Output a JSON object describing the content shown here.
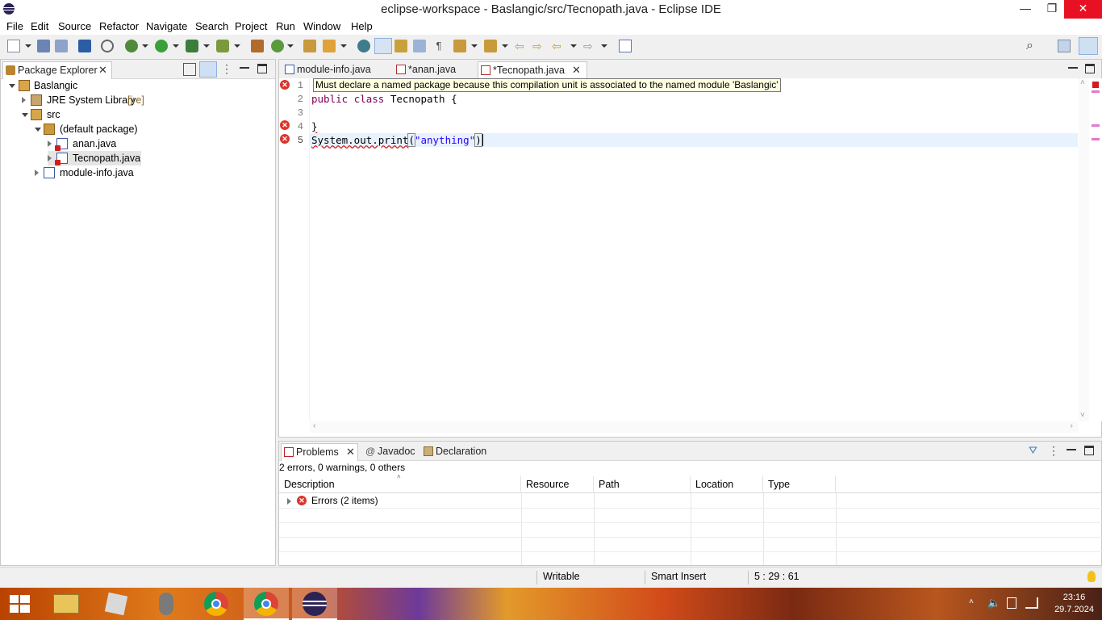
{
  "window": {
    "title": "eclipse-workspace - Baslangic/src/Tecnopath.java - Eclipse IDE",
    "controls": {
      "minimize": "—",
      "maximize": "❐",
      "close": "✕"
    }
  },
  "menu": {
    "items": [
      "File",
      "Edit",
      "Source",
      "Refactor",
      "Navigate",
      "Search",
      "Project",
      "Run",
      "Window",
      "Help"
    ]
  },
  "package_explorer": {
    "tab_label": "Package Explorer",
    "tree": {
      "project": "Baslangic",
      "jre_label": "JRE System Library",
      "jre_suffix": "[jre]",
      "src": "src",
      "default_package": "(default package)",
      "file_anan": "anan.java",
      "file_tecnopath": "Tecnopath.java",
      "file_module_info": "module-info.java"
    }
  },
  "editor": {
    "tabs": [
      "module-info.java",
      "*anan.java",
      "*Tecnopath.java"
    ],
    "active_tab": 2,
    "line_numbers": [
      "1",
      "2",
      "3",
      "4",
      "5"
    ],
    "tooltip": "Must declare a named package because this compilation unit is associated to the named module 'Baslangic'",
    "code": {
      "line2_kw1": "public",
      "line2_kw2": "class",
      "line2_rest": " Tecnopath {",
      "line4": "}",
      "line5_pre": "System.out.print",
      "line5_paren": "(",
      "line5_str": "\"anything\"",
      "line5_close": ")"
    }
  },
  "problems_view": {
    "tabs": [
      "Problems",
      "Javadoc",
      "Declaration"
    ],
    "summary": "2 errors, 0 warnings, 0 others",
    "columns": [
      "Description",
      "Resource",
      "Path",
      "Location",
      "Type"
    ],
    "rows": [
      {
        "label": "Errors (2 items)"
      }
    ]
  },
  "status_bar": {
    "writable": "Writable",
    "insert_mode": "Smart Insert",
    "position": "5 : 29 : 61"
  },
  "taskbar": {
    "time": "23:16",
    "date": "29.7.2024"
  },
  "colors": {
    "keyword": "#7f0055",
    "string": "#2a00ff",
    "error": "#d9352c",
    "tooltip_bg": "#ffffe1",
    "close_button": "#e81123"
  }
}
